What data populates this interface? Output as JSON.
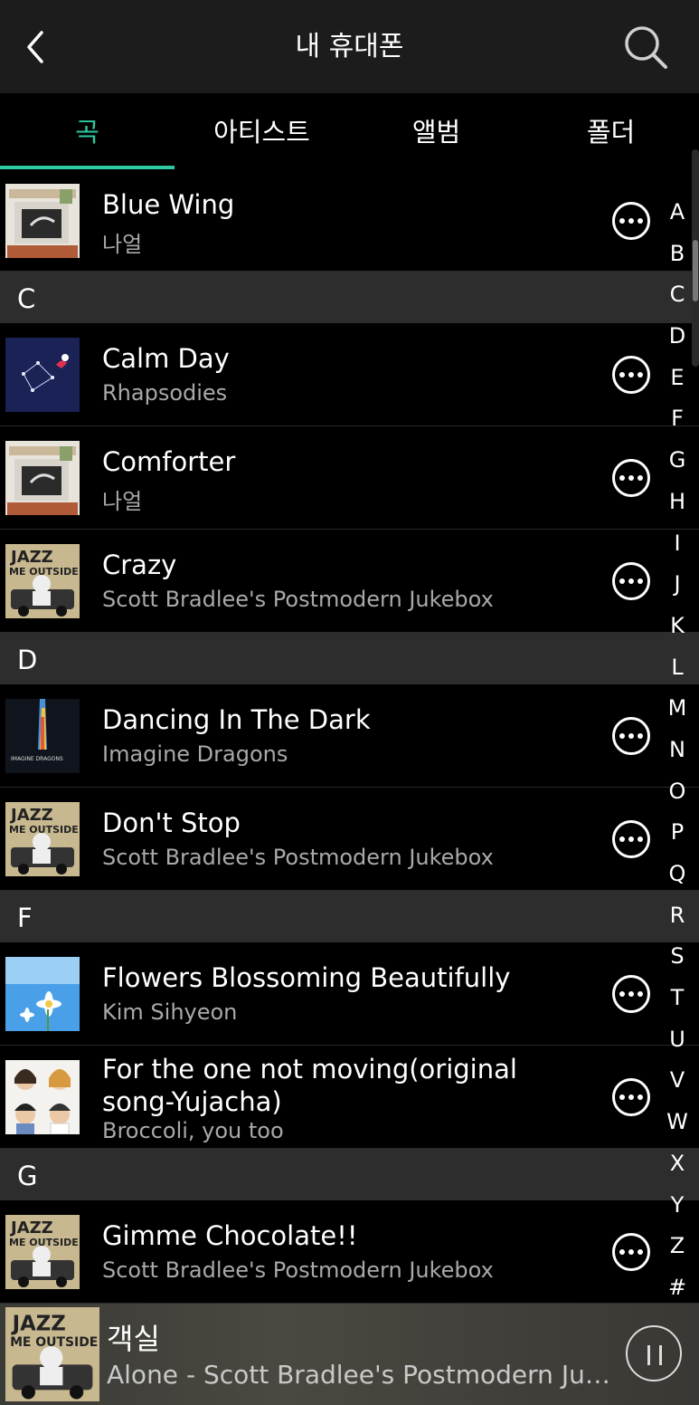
{
  "header": {
    "title": "내 휴대폰"
  },
  "tabs": [
    {
      "label": "곡"
    },
    {
      "label": "아티스트"
    },
    {
      "label": "앨범"
    },
    {
      "label": "폴더"
    }
  ],
  "songs": {
    "blue_wing": {
      "title": "Blue Wing",
      "artist": "나얼"
    },
    "calm_day": {
      "title": "Calm Day",
      "artist": "Rhapsodies"
    },
    "comforter": {
      "title": "Comforter",
      "artist": "나얼"
    },
    "crazy": {
      "title": "Crazy",
      "artist": "Scott Bradlee's Postmodern Jukebox"
    },
    "dancing": {
      "title": "Dancing In The Dark",
      "artist": "Imagine Dragons"
    },
    "dont_stop": {
      "title": "Don't Stop",
      "artist": "Scott Bradlee's Postmodern Jukebox"
    },
    "flowers": {
      "title": "Flowers Blossoming Beautifully",
      "artist": "Kim Sihyeon"
    },
    "for_the_one": {
      "title": "For the one not moving(original song-Yujacha)",
      "artist": "Broccoli, you too"
    },
    "gimme": {
      "title": "Gimme Chocolate!!",
      "artist": "Scott Bradlee's Postmodern Jukebox"
    }
  },
  "sections": {
    "c": "C",
    "d": "D",
    "f": "F",
    "g": "G"
  },
  "index_letters": [
    "A",
    "B",
    "C",
    "D",
    "E",
    "F",
    "G",
    "H",
    "I",
    "J",
    "K",
    "L",
    "M",
    "N",
    "O",
    "P",
    "Q",
    "R",
    "S",
    "T",
    "U",
    "V",
    "W",
    "X",
    "Y",
    "Z",
    "#"
  ],
  "player": {
    "title": "객실",
    "subtitle": "Alone - Scott Bradlee's Postmodern Jukebox"
  },
  "colors": {
    "accent": "#2ec9a0",
    "section_bg": "#2d2d2d",
    "header_bg": "#1c1c1c"
  }
}
